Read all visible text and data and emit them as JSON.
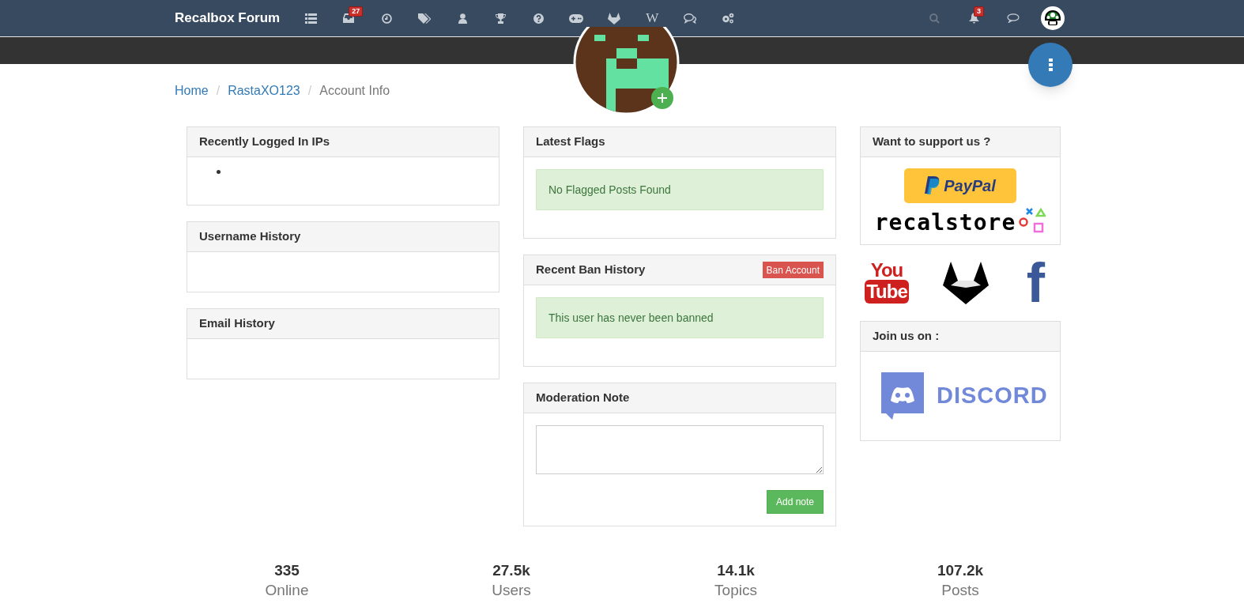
{
  "navbar": {
    "brand": "Recalbox Forum",
    "nav_icons": [
      {
        "kind": "list"
      },
      {
        "kind": "inbox",
        "badge": "27"
      },
      {
        "kind": "clock"
      },
      {
        "kind": "tags"
      },
      {
        "kind": "user"
      },
      {
        "kind": "trophy"
      },
      {
        "kind": "question"
      },
      {
        "kind": "gamepad"
      },
      {
        "kind": "fox"
      },
      {
        "kind": "glyph",
        "glyph": "W"
      },
      {
        "kind": "comments"
      },
      {
        "kind": "cogs"
      }
    ],
    "right_icons": [
      {
        "kind": "search"
      },
      {
        "kind": "bell",
        "badge": "3"
      },
      {
        "kind": "chat"
      },
      {
        "kind": "avatar"
      }
    ]
  },
  "breadcrumbs": [
    {
      "label": "Home",
      "link": true
    },
    {
      "label": "RastaXO123",
      "link": true,
      "separator": "/"
    },
    {
      "label": "Account Info",
      "link": false,
      "separator": "/"
    }
  ],
  "columns": [
    [
      {
        "title": "Recently Logged In IPs",
        "kind": "bullet"
      },
      {
        "title": "Username History",
        "kind": "empty"
      },
      {
        "title": "Email History",
        "kind": "empty"
      }
    ],
    [
      {
        "title": "Latest Flags",
        "kind": "alert",
        "message": "No Flagged Posts Found"
      },
      {
        "title": "Recent Ban History",
        "kind": "alert",
        "message": "This user has never been banned",
        "header_button": "Ban Account"
      },
      {
        "title": "Moderation Note",
        "kind": "note",
        "button": "Add note"
      }
    ]
  ],
  "sidebar": {
    "support_title": "Want to support us ?",
    "paypal": "PayPal",
    "store": "recalstore",
    "social": [
      {
        "kind": "youtube",
        "line1": "You",
        "line2": "Tube"
      },
      {
        "kind": "fox"
      },
      {
        "kind": "facebook",
        "glyph": "f"
      }
    ],
    "join_title": "Join us on :",
    "discord": "DISCORD"
  },
  "stats": [
    {
      "value": "335",
      "label": "Online"
    },
    {
      "value": "27.5k",
      "label": "Users"
    },
    {
      "value": "14.1k",
      "label": "Topics"
    },
    {
      "value": "107.2k",
      "label": "Posts"
    }
  ]
}
